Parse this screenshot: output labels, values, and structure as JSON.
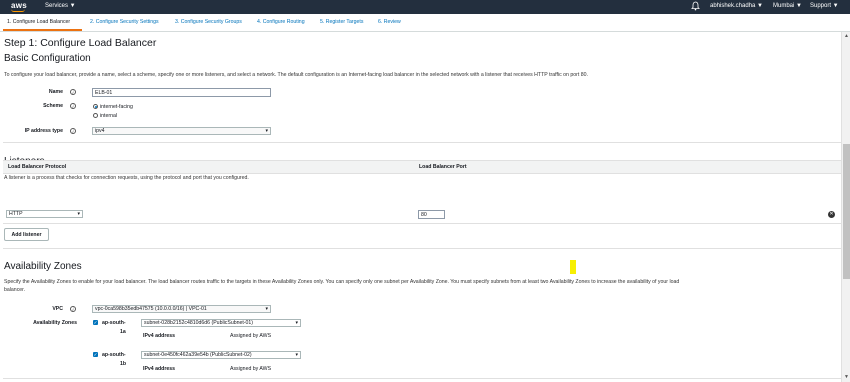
{
  "topbar": {
    "logo": "aws",
    "services": "Services ▼",
    "bell_icon": "bell-icon",
    "user": "abhishek.chadha ▼",
    "region": "Mumbai ▼",
    "support": "Support ▼"
  },
  "tabs": [
    {
      "label": "1. Configure Load Balancer"
    },
    {
      "label": "2. Configure Security Settings"
    },
    {
      "label": "3. Configure Security Groups"
    },
    {
      "label": "4. Configure Routing"
    },
    {
      "label": "5. Register Targets"
    },
    {
      "label": "6. Review"
    }
  ],
  "page": {
    "title": "Step 1: Configure Load Balancer",
    "basic": {
      "heading": "Basic Configuration",
      "description": "To configure your load balancer, provide a name, select a scheme, specify one or more listeners, and select a network. The default configuration is an Internet-facing load balancer in the selected network with a listener that receives HTTP traffic on port 80.",
      "name_label": "Name",
      "name_value": "ELB-01",
      "scheme_label": "Scheme",
      "scheme_options": [
        "internet-facing",
        "internal"
      ],
      "ip_label": "IP address type",
      "ip_value": "ipv4"
    },
    "listeners": {
      "heading": "Listeners",
      "description": "A listener is a process that checks for connection requests, using the protocol and port that you configured.",
      "col_protocol": "Load Balancer Protocol",
      "col_port": "Load Balancer Port",
      "protocol_value": "HTTP",
      "port_value": "80",
      "add_button": "Add listener"
    },
    "az": {
      "heading": "Availability Zones",
      "description_line1": "Specify the Availability Zones to enable for your load balancer. The load balancer routes traffic to the targets in these Availability Zones only. You can specify only one subnet per Availability Zone. You must specify subnets from at least two Availability Zones to increase the availability of your load",
      "description_line2": "balancer.",
      "vpc_label": "VPC",
      "vpc_value": "vpc-0ca598b35edb47575 (10.0.0.0/16) | VPC-01",
      "zones_label": "Availability Zones",
      "zones": [
        {
          "name_line1": "ap-south-",
          "name_line2": "1a",
          "subnet": "subnet-028b2152c4810d6d6 (PublicSubnet-01)",
          "ipv4_label": "IPv4 address",
          "ipv4_value": "Assigned by AWS"
        },
        {
          "name_line1": "ap-south-",
          "name_line2": "1b",
          "subnet": "subnet-0e450fc462a39e54b (PublicSubnet-02)",
          "ipv4_label": "IPv4 address",
          "ipv4_value": "Assigned by AWS"
        }
      ]
    }
  },
  "colors": {
    "topbar": "#232f3e",
    "accent": "#ec7211",
    "link": "#0073bb"
  }
}
